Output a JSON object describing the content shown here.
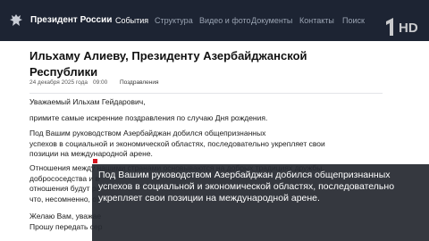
{
  "header": {
    "site_title": "Президент России",
    "nav": [
      {
        "label": "События",
        "active": true
      },
      {
        "label": "Структура",
        "active": false
      },
      {
        "label": "Видео и фото",
        "active": false
      },
      {
        "label": "Документы",
        "active": false
      },
      {
        "label": "Контакты",
        "active": false
      },
      {
        "label": "Поиск",
        "active": false
      }
    ],
    "emblem_icon": "double-headed-eagle-icon",
    "channel_logo_icon": "channel-one-logo",
    "channel_logo_text": "HD"
  },
  "article": {
    "title_line1": "Ильхаму Алиеву, Президенту Азербайджанской",
    "title_line2": "Республики",
    "date": "24 декабря 2025 года",
    "time": "09:00",
    "category": "Поздравления",
    "paragraphs": [
      [
        "Уважаемый Ильхам Гейдарович,"
      ],
      [
        "примите самые искренние поздравления по случаю Дня рождения."
      ],
      [
        "Под Вашим руководством Азербайджан добился общепризнанных",
        "успехов в социальной и экономической областях, последовательно укрепляет свои",
        "позиции на международной арене."
      ],
      [
        "Отношения между нашими странами основываются на добрых традициях дружбы,",
        "добрососедства и в",
        "отношения будут ра",
        "что, несомненно, от"
      ],
      [
        "Желаю Вам, уважае",
        "Прошу передать сер"
      ]
    ]
  },
  "caption": {
    "lines": [
      "Под Вашим руководством Азербайджан добился общепризнанных",
      "успехов в социальной и экономической областях, последовательно",
      "укрепляет свои позиции на международной арене."
    ]
  },
  "colors": {
    "topbar": "#1d2433",
    "caption_bg": "#262930",
    "caption_mark": "#d8141f"
  }
}
